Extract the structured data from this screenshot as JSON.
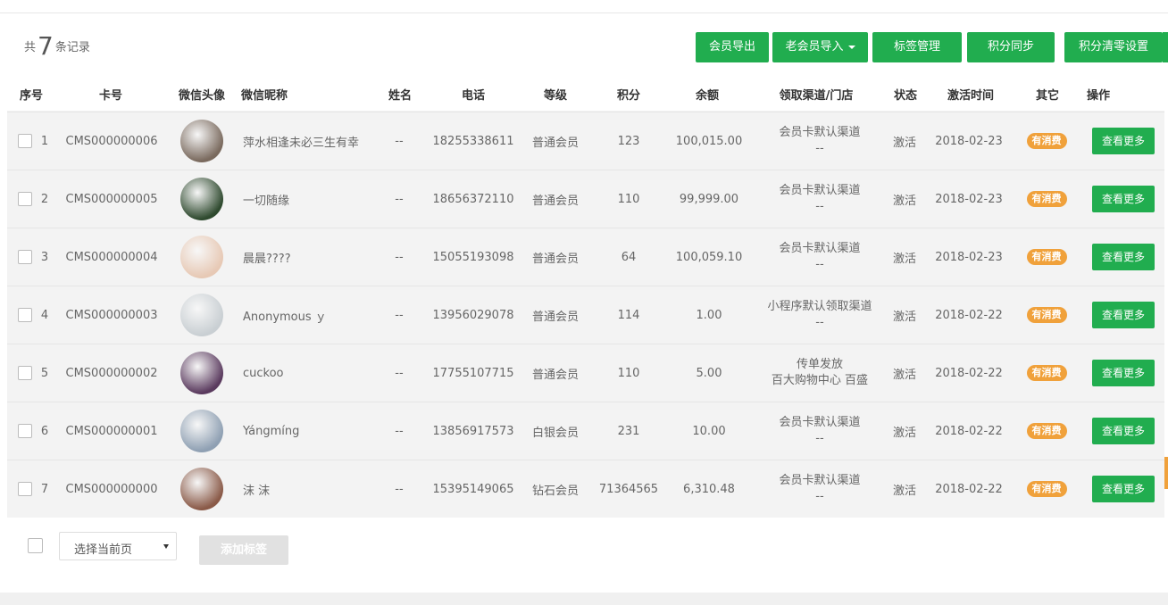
{
  "summary": {
    "prefix": "共",
    "count": "7",
    "suffix": "条记录"
  },
  "toolbar": {
    "export": "会员导出",
    "import": "老会员导入",
    "tags": "标签管理",
    "sync": "积分同步",
    "reset": "积分清零设置"
  },
  "columns": {
    "index": "序号",
    "card": "卡号",
    "avatar": "微信头像",
    "nickname": "微信昵称",
    "name": "姓名",
    "phone": "电话",
    "level": "等级",
    "points": "积分",
    "balance": "余额",
    "channel": "领取渠道/门店",
    "status": "状态",
    "activated": "激活时间",
    "other": "其它",
    "action": "操作"
  },
  "rows": [
    {
      "index": "1",
      "card": "CMS000000006",
      "nickname": "萍水相逢未必三生有幸",
      "name": "--",
      "phone": "18255338611",
      "level": "普通会员",
      "points": "123",
      "balance": "100,015.00",
      "channel1": "会员卡默认渠道",
      "channel2": "--",
      "status": "激活",
      "activated": "2018-02-23",
      "badge": "有消费",
      "action": "查看更多",
      "avatar_color": "#7a6a5e"
    },
    {
      "index": "2",
      "card": "CMS000000005",
      "nickname": "一切随缘",
      "name": "--",
      "phone": "18656372110",
      "level": "普通会员",
      "points": "110",
      "balance": "99,999.00",
      "channel1": "会员卡默认渠道",
      "channel2": "--",
      "status": "激活",
      "activated": "2018-02-23",
      "badge": "有消费",
      "action": "查看更多",
      "avatar_color": "#2f4a2f"
    },
    {
      "index": "3",
      "card": "CMS000000004",
      "nickname": "晨晨????",
      "name": "--",
      "phone": "15055193098",
      "level": "普通会员",
      "points": "64",
      "balance": "100,059.10",
      "channel1": "会员卡默认渠道",
      "channel2": "--",
      "status": "激活",
      "activated": "2018-02-23",
      "badge": "有消费",
      "action": "查看更多",
      "avatar_color": "#e7c9b5"
    },
    {
      "index": "4",
      "card": "CMS000000003",
      "nickname": "Anonymous ｙ",
      "name": "--",
      "phone": "13956029078",
      "level": "普通会员",
      "points": "114",
      "balance": "1.00",
      "channel1": "小程序默认领取渠道",
      "channel2": "--",
      "status": "激活",
      "activated": "2018-02-22",
      "badge": "有消费",
      "action": "查看更多",
      "avatar_color": "#c9cfd3"
    },
    {
      "index": "5",
      "card": "CMS000000002",
      "nickname": "cuckoo",
      "name": "--",
      "phone": "17755107715",
      "level": "普通会员",
      "points": "110",
      "balance": "5.00",
      "channel1": "传单发放",
      "channel2": "百大购物中心 百盛",
      "status": "激活",
      "activated": "2018-02-22",
      "badge": "有消费",
      "action": "查看更多",
      "avatar_color": "#5a3a5e"
    },
    {
      "index": "6",
      "card": "CMS000000001",
      "nickname": "Yángmíng",
      "name": "--",
      "phone": "13856917573",
      "level": "白银会员",
      "points": "231",
      "balance": "10.00",
      "channel1": "会员卡默认渠道",
      "channel2": "--",
      "status": "激活",
      "activated": "2018-02-22",
      "badge": "有消费",
      "action": "查看更多",
      "avatar_color": "#8fa0b3"
    },
    {
      "index": "7",
      "card": "CMS000000000",
      "nickname": "沫 沫",
      "name": "--",
      "phone": "15395149065",
      "level": "钻石会员",
      "points": "71364565",
      "balance": "6,310.48",
      "channel1": "会员卡默认渠道",
      "channel2": "--",
      "status": "激活",
      "activated": "2018-02-22",
      "badge": "有消费",
      "action": "查看更多",
      "avatar_color": "#8a5a48"
    }
  ],
  "footer": {
    "select_label": "选择当前页",
    "tag_button": "添加标签"
  }
}
